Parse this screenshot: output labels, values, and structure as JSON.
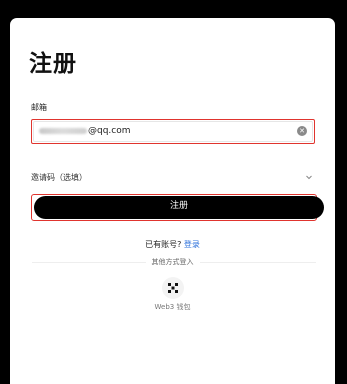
{
  "page": {
    "title": "注册"
  },
  "email": {
    "label": "邮箱",
    "value": "@qq.com"
  },
  "invite": {
    "label": "邀请码（选填）"
  },
  "submit": {
    "label": "注册"
  },
  "login_prompt": {
    "text": "已有账号?",
    "link": "登录"
  },
  "other_login": {
    "label": "其他方式登入",
    "web3_label": "Web3 钱包"
  },
  "icons": {
    "clear": "clear-icon",
    "chevron": "chevron-down-icon",
    "web3": "web3-wallet-icon"
  },
  "colors": {
    "accent_link": "#2a6fdb",
    "highlight_border": "#e0342e",
    "button_bg": "#000000"
  }
}
